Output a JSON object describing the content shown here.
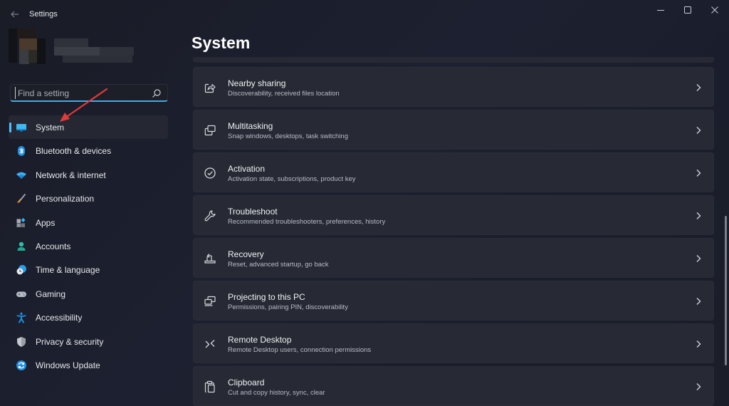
{
  "window": {
    "title": "Settings",
    "controls": {
      "minimize": "minimize-icon",
      "maximize": "maximize-icon",
      "close": "close-icon"
    }
  },
  "profile": {
    "state": "pixelated/blurred user avatar and name"
  },
  "search": {
    "placeholder": "Find a setting",
    "value": ""
  },
  "sidebar": {
    "items": [
      {
        "label": "System",
        "icon": "monitor-icon",
        "active": true
      },
      {
        "label": "Bluetooth & devices",
        "icon": "bluetooth-icon",
        "active": false
      },
      {
        "label": "Network & internet",
        "icon": "wifi-icon",
        "active": false
      },
      {
        "label": "Personalization",
        "icon": "brush-icon",
        "active": false
      },
      {
        "label": "Apps",
        "icon": "apps-icon",
        "active": false
      },
      {
        "label": "Accounts",
        "icon": "person-icon",
        "active": false
      },
      {
        "label": "Time & language",
        "icon": "clock-globe-icon",
        "active": false
      },
      {
        "label": "Gaming",
        "icon": "gamepad-icon",
        "active": false
      },
      {
        "label": "Accessibility",
        "icon": "accessibility-icon",
        "active": false
      },
      {
        "label": "Privacy & security",
        "icon": "shield-icon",
        "active": false
      },
      {
        "label": "Windows Update",
        "icon": "update-icon",
        "active": false
      }
    ]
  },
  "annotation": {
    "type": "red-arrow",
    "points_to": "System"
  },
  "main": {
    "title": "System",
    "cards": [
      {
        "title": "Nearby sharing",
        "subtitle": "Discoverability, received files location",
        "icon": "share-icon"
      },
      {
        "title": "Multitasking",
        "subtitle": "Snap windows, desktops, task switching",
        "icon": "multitasking-icon"
      },
      {
        "title": "Activation",
        "subtitle": "Activation state, subscriptions, product key",
        "icon": "check-circle-icon"
      },
      {
        "title": "Troubleshoot",
        "subtitle": "Recommended troubleshooters, preferences, history",
        "icon": "wrench-icon"
      },
      {
        "title": "Recovery",
        "subtitle": "Reset, advanced startup, go back",
        "icon": "recovery-icon"
      },
      {
        "title": "Projecting to this PC",
        "subtitle": "Permissions, pairing PIN, discoverability",
        "icon": "projecting-icon"
      },
      {
        "title": "Remote Desktop",
        "subtitle": "Remote Desktop users, connection permissions",
        "icon": "remote-desktop-icon"
      },
      {
        "title": "Clipboard",
        "subtitle": "Cut and copy history, sync, clear",
        "icon": "clipboard-icon"
      }
    ]
  },
  "colors": {
    "accent": "#4cc2ff",
    "search_underline": "#4aa8e0",
    "annotation_arrow": "#e03a3a",
    "card_bg": "#272a34",
    "window_bg": "#1c1f2a"
  }
}
